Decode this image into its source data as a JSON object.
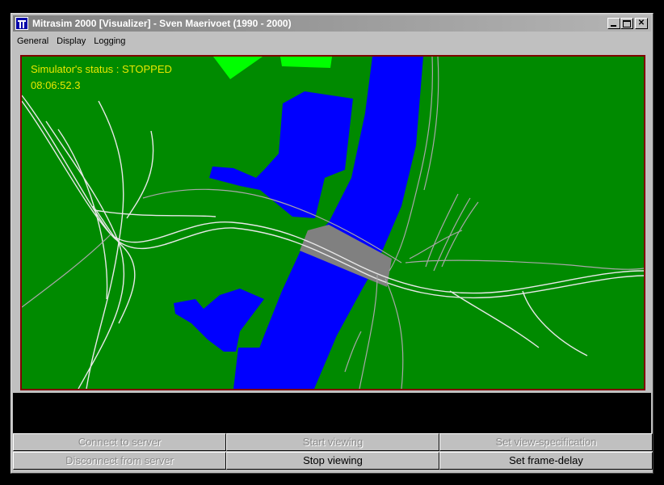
{
  "window": {
    "title": "Mitrasim 2000 [Visualizer] - Sven Maerivoet (1990 - 2000)",
    "icon": "motorway-sign-icon"
  },
  "menu": [
    "General",
    "Display",
    "Logging"
  ],
  "viewer": {
    "status_text": "Simulator's status : STOPPED",
    "clock": "08:06:52.3"
  },
  "buttons": {
    "connect": "Connect to server",
    "start": "Start viewing",
    "set_view": "Set view-specification",
    "disconnect": "Disconnect from server",
    "stop": "Stop viewing",
    "frame_delay": "Set frame-delay"
  },
  "colors": {
    "land": "#008a00",
    "water": "#0000ff",
    "bright_land": "#00ff00",
    "status_text": "#e8e800",
    "frame_border": "#800000"
  }
}
